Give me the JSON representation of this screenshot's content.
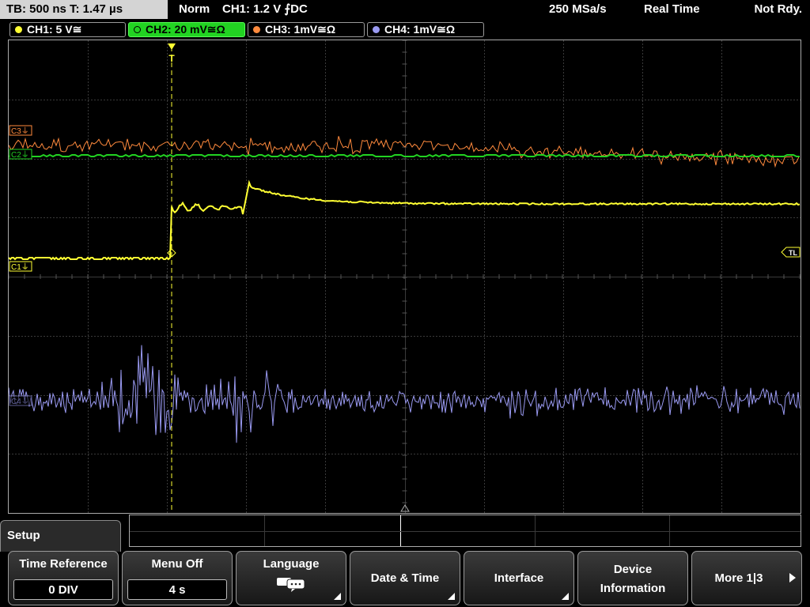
{
  "status_bar": {
    "timebase": "TB: 500 ns   T: 1.47 µs",
    "mode": "Norm",
    "trigger": "CH1: 1.2 V ⨍DC",
    "sample_rate": "250 MSa/s",
    "acq_mode": "Real Time",
    "status": "Not Rdy."
  },
  "channels": [
    {
      "label": "CH1: 5 V≅",
      "color": "#ffff33",
      "active": false
    },
    {
      "label": "CH2: 20 mV≅Ω",
      "color": "#22d322",
      "active": true
    },
    {
      "label": "CH3: 1mV≅Ω",
      "color": "#ff8a3d",
      "active": false
    },
    {
      "label": "CH4: 1mV≅Ω",
      "color": "#9a9af2",
      "active": false
    }
  ],
  "markers": {
    "c3": "C3⏚",
    "c2": "C2⏚",
    "c1": "C1⏚",
    "c4": "C4⏚",
    "trigger_level": "TL",
    "trigger_position": "T"
  },
  "menu": {
    "title": "Setup",
    "softkeys": [
      {
        "title": "Time Reference",
        "value": "0 DIV"
      },
      {
        "title": "Menu Off",
        "value": "4 s"
      },
      {
        "title": "Language",
        "icon": "speech-bubbles-icon"
      },
      {
        "title": "Date & Time"
      },
      {
        "title": "Interface"
      },
      {
        "title": "Device",
        "title2": "Information"
      },
      {
        "title": "More 1|3",
        "icon": "play-arrow-icon"
      }
    ]
  },
  "colors": {
    "grid": "#3a3a3a",
    "ch1": "#ffff33",
    "ch2": "#22d322",
    "ch3": "#ff8a3d",
    "ch4": "#9a9af2"
  }
}
